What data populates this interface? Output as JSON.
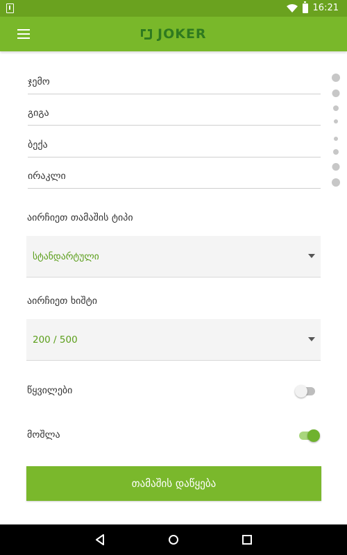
{
  "status_bar": {
    "time": "16:21",
    "left_icon": "download-notification-icon",
    "wifi_icon": "wifi-icon",
    "battery_icon": "battery-icon"
  },
  "app_bar": {
    "menu_icon": "menu-icon",
    "logo_text": "JOKER",
    "color": "#79b82a"
  },
  "players": [
    {
      "value": "ჯემო"
    },
    {
      "value": "გიგა"
    },
    {
      "value": "ბექა"
    },
    {
      "value": "ირაკლი"
    }
  ],
  "game_type": {
    "label": "აირჩიეთ თამაშის ტიპი",
    "selected": "სტანდარტული"
  },
  "penalty": {
    "label": "აირჩიეთ ხიშტი",
    "selected": "200 / 500"
  },
  "toggles": {
    "tricks": {
      "label": "წყვილები",
      "on": false
    },
    "erase": {
      "label": "მოშლა",
      "on": true
    }
  },
  "start_button": {
    "label": "თამაშის დაწყება"
  },
  "colors": {
    "accent": "#79b82a",
    "accent_dark": "#5a9e19",
    "logo": "#2f7a1f"
  }
}
